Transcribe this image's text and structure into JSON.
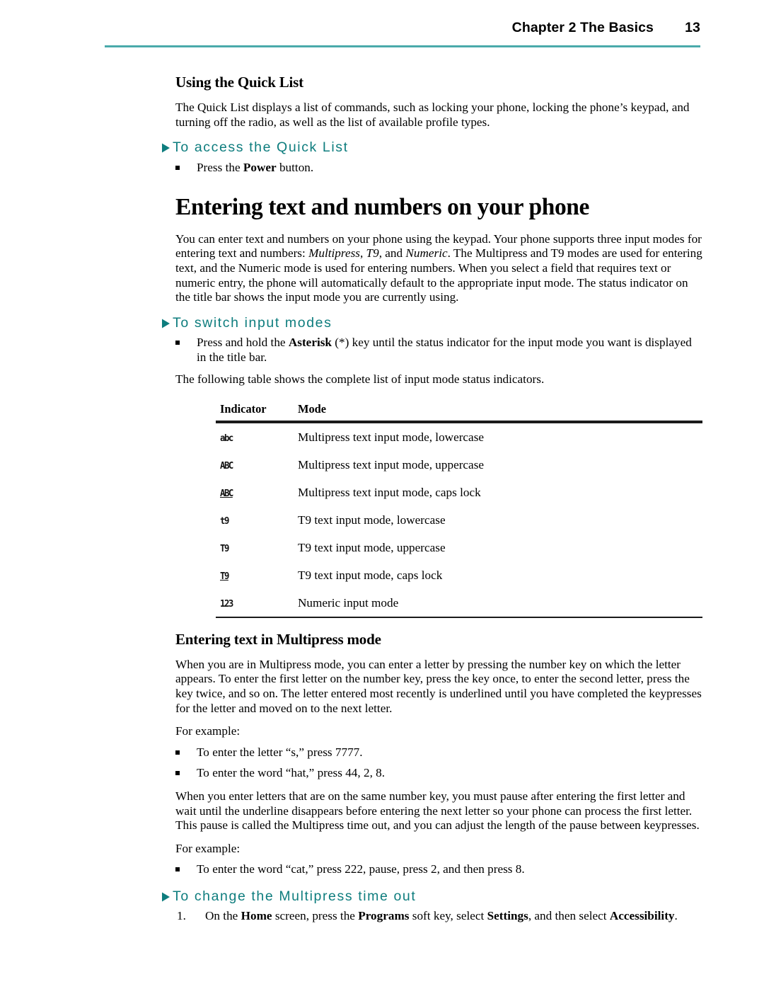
{
  "header": {
    "chapter": "Chapter 2 The Basics",
    "page_number": "13",
    "rule_color": "#4aaaab"
  },
  "theme": {
    "accent_teal": "#0e7d7e",
    "rule_teal": "#4aaaab",
    "text_black": "#000000"
  },
  "sections": {
    "quick_list": {
      "title": "Using the Quick List",
      "paragraph": "The Quick List displays a list of commands, such as locking your phone, locking the phone’s keypad, and turning off the radio, as well as the list of available profile types.",
      "procedure_heading": "To access the Quick List",
      "bullet_1_pre": "Press the ",
      "bullet_1_bold": "Power",
      "bullet_1_post": " button."
    },
    "entering_text": {
      "heading": "Entering text and numbers on your phone",
      "intro_a": "You can enter text and numbers on your phone using the keypad. Your phone supports three input modes for entering text and numbers: ",
      "intro_italic_1": "Multipress",
      "intro_b": ", ",
      "intro_italic_2": "T9",
      "intro_c": ", and ",
      "intro_italic_3": "Numeric",
      "intro_d": ". The Multipress and T9 modes are used for entering text, and the Numeric mode is used for entering numbers. When you select a field that requires text or numeric entry, the phone will automatically default to the appropriate input mode. The status indicator on the title bar shows the input mode you are currently using.",
      "procedure_heading": "To switch input modes",
      "bullet_pre": "Press and hold the ",
      "bullet_bold": "Asterisk",
      "bullet_post": " (*) key until the status indicator for the input mode you want is displayed in the title bar.",
      "table_intro": "The following table shows the complete list of input mode status indicators."
    },
    "multipress": {
      "title": "Entering text in Multipress mode",
      "paragraph": "When you are in Multipress mode, you can enter a letter by pressing the number key on which the letter appears. To enter the first letter on the number key, press the key once, to enter the second letter, press the key twice, and so on. The letter entered most recently is underlined until you have completed the keypresses for the letter and moved on to the next letter.",
      "for_example_1": "For example:",
      "examples_1": [
        "To enter the letter “s,” press 7777.",
        "To enter the word “hat,” press 44, 2, 8."
      ],
      "paragraph_2": "When you enter letters that are on the same number key, you must pause after entering the first letter and wait until the underline disappears before entering the next letter so your phone can process the first letter. This pause is called the Multipress time out, and you can adjust the length of the pause between keypresses.",
      "for_example_2": "For example:",
      "examples_2": [
        "To enter the word “cat,” press 222, pause, press 2, and then press 8."
      ],
      "procedure_heading": "To change the Multipress time out",
      "step_1": {
        "number": "1.",
        "part_a": "On the ",
        "bold_1": "Home",
        "part_b": " screen, press the ",
        "bold_2": "Programs",
        "part_c": " soft key, select ",
        "bold_3": "Settings",
        "part_d": ", and then select ",
        "bold_4": "Accessibility",
        "part_e": "."
      }
    }
  },
  "indicator_table": {
    "columns": [
      "Indicator",
      "Mode"
    ],
    "rows": [
      {
        "indicator": "abc",
        "underlined": false,
        "mode": "Multipress text input mode, lowercase"
      },
      {
        "indicator": "ABC",
        "underlined": false,
        "mode": "Multipress text input mode, uppercase"
      },
      {
        "indicator": "ABC",
        "underlined": true,
        "mode": "Multipress text input mode, caps lock"
      },
      {
        "indicator": "t9",
        "underlined": false,
        "mode": "T9 text input mode, lowercase"
      },
      {
        "indicator": "T9",
        "underlined": false,
        "mode": "T9 text input mode, uppercase"
      },
      {
        "indicator": "T9",
        "underlined": true,
        "mode": "T9 text input mode, caps lock"
      },
      {
        "indicator": "123",
        "underlined": false,
        "mode": "Numeric input mode"
      }
    ]
  }
}
